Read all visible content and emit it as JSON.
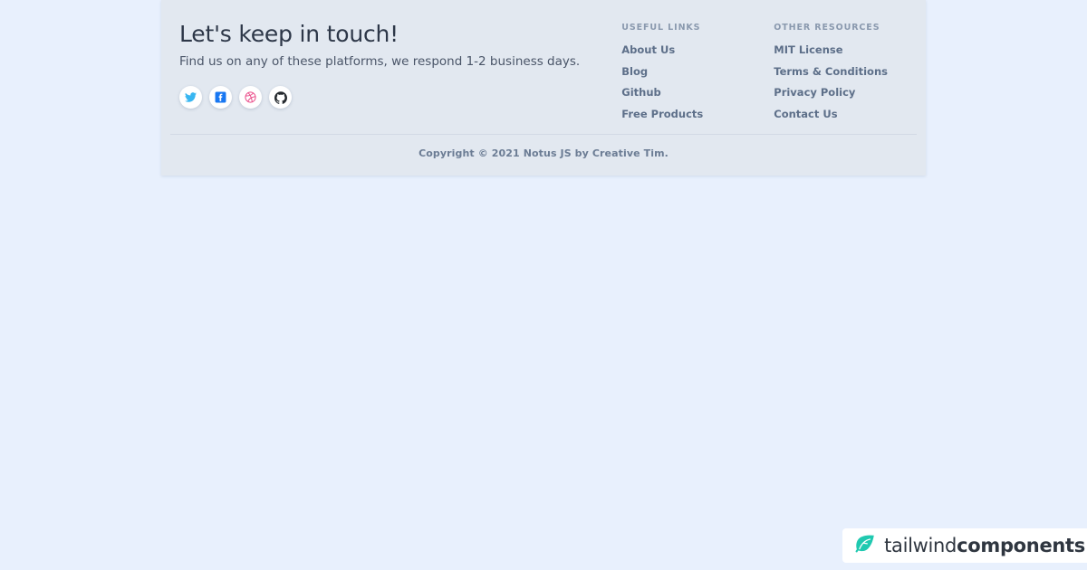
{
  "footer": {
    "brand": {
      "title": "Let's keep in touch!",
      "subtitle": "Find us on any of these platforms, we respond 1-2 business days."
    },
    "social": [
      {
        "name": "twitter",
        "label": "Twitter",
        "color": "#38b6f1"
      },
      {
        "name": "facebook",
        "label": "Facebook",
        "color": "#1877f2"
      },
      {
        "name": "dribbble",
        "label": "Dribbble",
        "color": "#ea4c89"
      },
      {
        "name": "github",
        "label": "Github",
        "color": "#24292e"
      }
    ],
    "columns": [
      {
        "title": "USEFUL LINKS",
        "links": [
          "About Us",
          "Blog",
          "Github",
          "Free Products"
        ]
      },
      {
        "title": "OTHER RESOURCES",
        "links": [
          "MIT License",
          "Terms & Conditions",
          "Privacy Policy",
          "Contact Us"
        ]
      }
    ],
    "copyright": "Copyright © 2021 Notus JS by Creative Tim."
  },
  "watermark": {
    "text_light": "tailwind",
    "text_bold": "components",
    "leaf_color": "#20c9b0"
  },
  "colors": {
    "page_background": "#e8f0fd",
    "card_background": "#e2e8f0",
    "heading": "#2d3748",
    "body_text": "#4a5568",
    "link": "#5d6f89",
    "column_title": "#8a99ae",
    "divider": "#d2dae5"
  }
}
